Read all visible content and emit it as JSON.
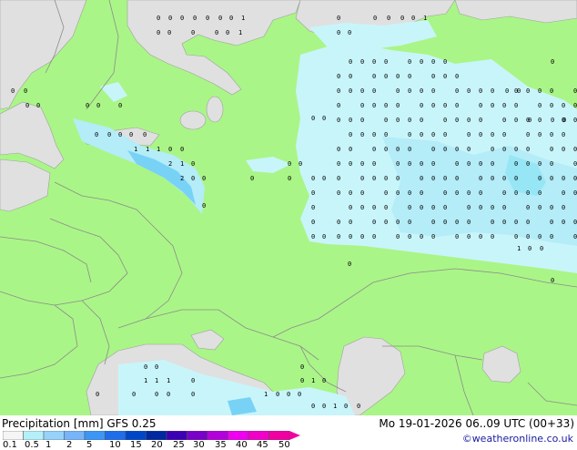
{
  "product": {
    "title_left": "Precipitation [mm]  GFS 0.25",
    "title_right": "Mo 19-01-2026 06..09 UTC (00+33)",
    "credit": "©weatheronline.co.uk"
  },
  "legend": {
    "labels": [
      "0.1",
      "0.5",
      "1",
      "2",
      "5",
      "10",
      "15",
      "20",
      "25",
      "30",
      "35",
      "40",
      "45",
      "50"
    ],
    "colors": [
      "#f5f5f5",
      "#b4f0fa",
      "#96d2fa",
      "#78b4fa",
      "#3c96f5",
      "#1e6eeb",
      "#0046c8",
      "#0028a0",
      "#3c00b4",
      "#7800c8",
      "#b400dc",
      "#f000f0",
      "#f000c8",
      "#f000a0"
    ]
  },
  "colors": {
    "land": "#aaf587",
    "sea": "#e0e0e0",
    "precip_light": "#c8f5fa",
    "precip_mid": "#96e6f5",
    "precip_strong": "#64d2f0",
    "border": "#8c8c8c"
  },
  "precip_digits": [
    "0",
    "1",
    "2"
  ]
}
